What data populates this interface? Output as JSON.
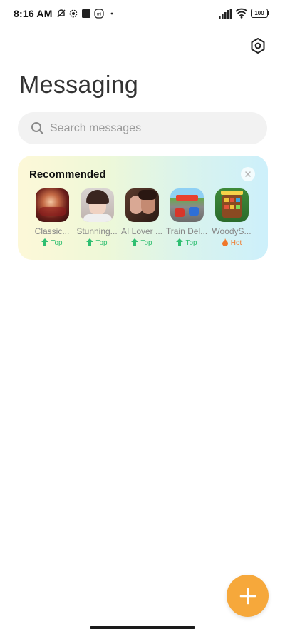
{
  "status_bar": {
    "time": "8:16 AM",
    "notification_icons": [
      "muted-notification-icon",
      "settings-gear-icon",
      "square-app-icon",
      "mi-icon",
      "dot-icon"
    ],
    "signal_icon": "signal-bars-icon",
    "wifi_icon": "wifi-icon",
    "battery": "100"
  },
  "header": {
    "settings_icon": "gear-icon",
    "title": "Messaging"
  },
  "search": {
    "placeholder": "Search messages",
    "value": ""
  },
  "recommended": {
    "title": "Recommended",
    "close_icon": "close-icon",
    "apps": [
      {
        "name": "Classic...",
        "badge": "Top",
        "badge_type": "top"
      },
      {
        "name": "Stunning...",
        "badge": "Top",
        "badge_type": "top"
      },
      {
        "name": "AI Lover ...",
        "badge": "Top",
        "badge_type": "top"
      },
      {
        "name": "Train Del...",
        "badge": "Top",
        "badge_type": "top"
      },
      {
        "name": "WoodyS...",
        "badge": "Hot",
        "badge_type": "hot"
      }
    ]
  },
  "fab": {
    "icon": "plus-icon"
  },
  "colors": {
    "accent": "#f6a83b",
    "top_badge": "#2fbf71",
    "hot_badge": "#f0782a"
  }
}
